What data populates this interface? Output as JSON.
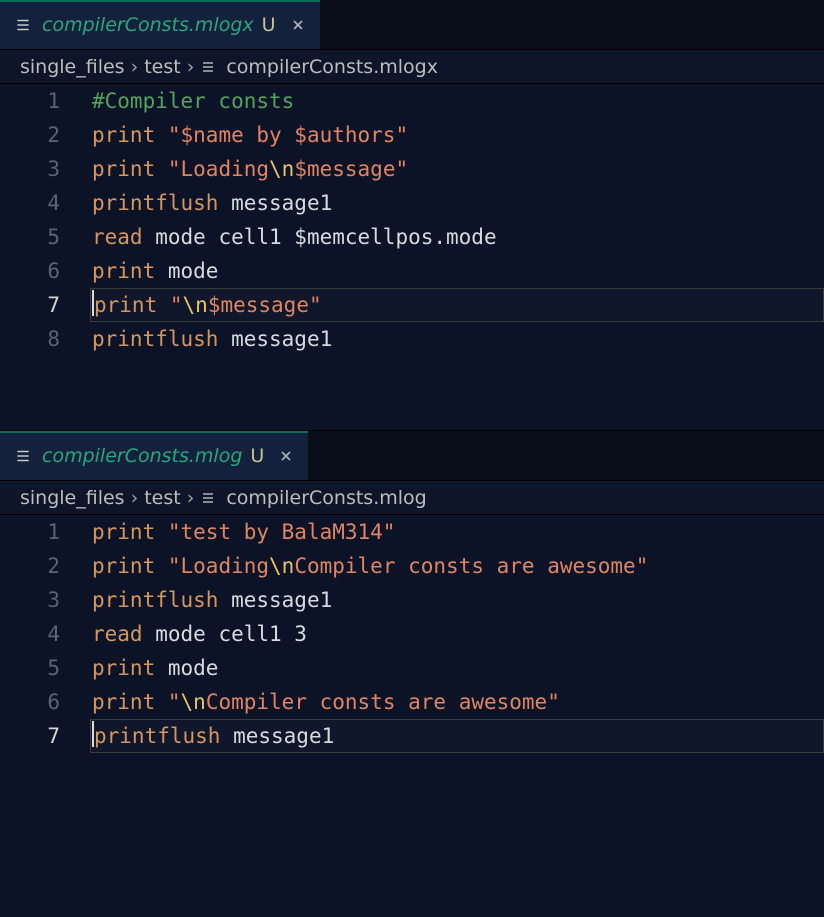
{
  "panes": [
    {
      "tab": {
        "filename": "compilerConsts.mlogx",
        "git_status": "U",
        "active": true
      },
      "breadcrumbs": [
        "single_files",
        "test",
        "compilerConsts.mlogx"
      ],
      "cursor_line": 7,
      "lines": [
        [
          [
            "comment",
            "#Compiler consts"
          ]
        ],
        [
          [
            "kw",
            "print"
          ],
          [
            "sp",
            " "
          ],
          [
            "str",
            "\"$name by $authors\""
          ]
        ],
        [
          [
            "kw",
            "print"
          ],
          [
            "sp",
            " "
          ],
          [
            "str",
            "\"Loading"
          ],
          [
            "esc",
            "\\n"
          ],
          [
            "str",
            "$message\""
          ]
        ],
        [
          [
            "kw",
            "printflush"
          ],
          [
            "sp",
            " "
          ],
          [
            "ident",
            "message1"
          ]
        ],
        [
          [
            "kw",
            "read"
          ],
          [
            "sp",
            " "
          ],
          [
            "ident",
            "mode cell1 $memcellpos.mode"
          ]
        ],
        [
          [
            "kw",
            "print"
          ],
          [
            "sp",
            " "
          ],
          [
            "ident",
            "mode"
          ]
        ],
        [
          [
            "kw",
            "print"
          ],
          [
            "sp",
            " "
          ],
          [
            "str",
            "\""
          ],
          [
            "esc",
            "\\n"
          ],
          [
            "str",
            "$message\""
          ]
        ],
        [
          [
            "kw",
            "printflush"
          ],
          [
            "sp",
            " "
          ],
          [
            "ident",
            "message1"
          ]
        ]
      ]
    },
    {
      "tab": {
        "filename": "compilerConsts.mlog",
        "git_status": "U",
        "active": true
      },
      "breadcrumbs": [
        "single_files",
        "test",
        "compilerConsts.mlog"
      ],
      "cursor_line": 7,
      "lines": [
        [
          [
            "kw",
            "print"
          ],
          [
            "sp",
            " "
          ],
          [
            "str",
            "\"test by BalaM314\""
          ]
        ],
        [
          [
            "kw",
            "print"
          ],
          [
            "sp",
            " "
          ],
          [
            "str",
            "\"Loading"
          ],
          [
            "esc",
            "\\n"
          ],
          [
            "str",
            "Compiler consts are awesome\""
          ]
        ],
        [
          [
            "kw",
            "printflush"
          ],
          [
            "sp",
            " "
          ],
          [
            "ident",
            "message1"
          ]
        ],
        [
          [
            "kw",
            "read"
          ],
          [
            "sp",
            " "
          ],
          [
            "ident",
            "mode cell1 3"
          ]
        ],
        [
          [
            "kw",
            "print"
          ],
          [
            "sp",
            " "
          ],
          [
            "ident",
            "mode"
          ]
        ],
        [
          [
            "kw",
            "print"
          ],
          [
            "sp",
            " "
          ],
          [
            "str",
            "\""
          ],
          [
            "esc",
            "\\n"
          ],
          [
            "str",
            "Compiler consts are awesome\""
          ]
        ],
        [
          [
            "kw",
            "printflush"
          ],
          [
            "sp",
            " "
          ],
          [
            "ident",
            "message1"
          ]
        ]
      ]
    }
  ]
}
